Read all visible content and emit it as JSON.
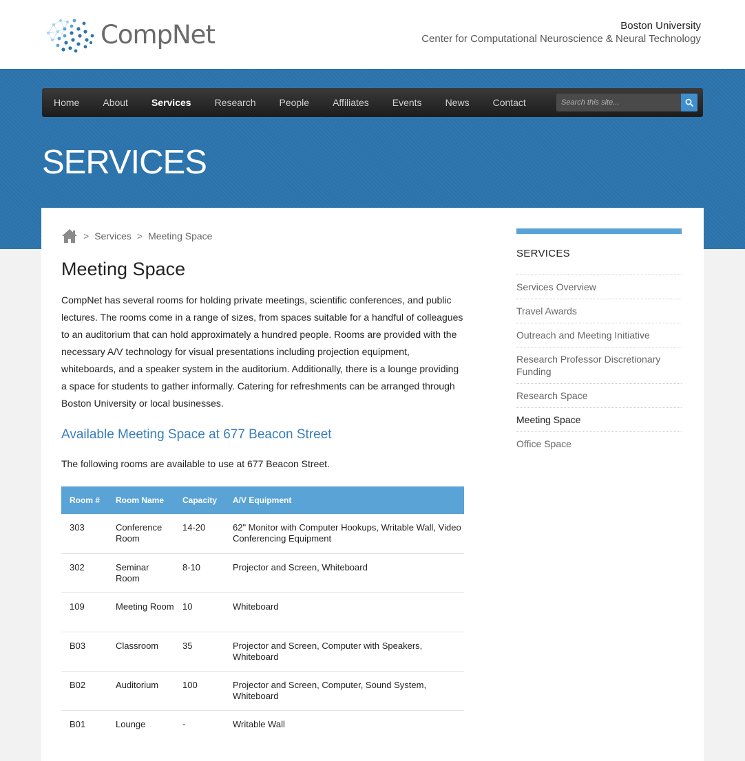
{
  "header": {
    "logo_text": "CompNet",
    "institution_name": "Boston University",
    "institution_sub": "Center for Computational Neuroscience & Neural Technology"
  },
  "nav": {
    "items": [
      {
        "label": "Home"
      },
      {
        "label": "About"
      },
      {
        "label": "Services",
        "active": true
      },
      {
        "label": "Research"
      },
      {
        "label": "People"
      },
      {
        "label": "Affiliates"
      },
      {
        "label": "Events"
      },
      {
        "label": "News"
      },
      {
        "label": "Contact"
      }
    ],
    "search_placeholder": "Search this site...",
    "search_icon": "search-icon"
  },
  "page": {
    "heading": "SERVICES"
  },
  "breadcrumb": {
    "home_icon": "home-icon",
    "sep": ">",
    "items": [
      "Services",
      "Meeting Space"
    ]
  },
  "content": {
    "title": "Meeting Space",
    "intro": "CompNet has several rooms for holding private meetings, scientific conferences, and public lectures. The rooms come in a range of sizes, from spaces suitable for a handful of colleagues to an auditorium that can hold approximately a hundred people. Rooms are provided with the necessary A/V technology for visual presentations including projection equipment, whiteboards, and a speaker system in the auditorium. Additionally, there is a lounge providing a space for students to gather informally. Catering for refreshments can be arranged through Boston University or local businesses.",
    "subheading": "Available Meeting Space at 677 Beacon Street",
    "rooms_intro": "The following rooms are available to use at 677 Beacon Street."
  },
  "table": {
    "headers": [
      "Room #",
      "Room Name",
      "Capacity",
      "A/V Equipment"
    ],
    "rows": [
      [
        "303",
        "Conference Room",
        "14-20",
        "62\" Monitor with Computer Hookups, Writable Wall, Video Conferencing Equipment"
      ],
      [
        "302",
        "Seminar Room",
        "8-10",
        "Projector and Screen, Whiteboard"
      ],
      [
        "109",
        "Meeting Room",
        "10",
        "Whiteboard"
      ],
      [
        "B03",
        "Classroom",
        "35",
        "Projector and Screen, Computer with Speakers, Whiteboard"
      ],
      [
        "B02",
        "Auditorium",
        "100",
        "Projector and Screen, Computer, Sound System, Whiteboard"
      ],
      [
        "B01",
        "Lounge",
        "-",
        "Writable Wall"
      ]
    ]
  },
  "sidebar": {
    "title": "SERVICES",
    "links": [
      {
        "label": "Services Overview"
      },
      {
        "label": "Travel Awards"
      },
      {
        "label": "Outreach and Meeting Initiative"
      },
      {
        "label": "Research Professor Discretionary Funding"
      },
      {
        "label": "Research Space"
      },
      {
        "label": "Meeting Space",
        "current": true
      },
      {
        "label": "Office Space"
      }
    ]
  },
  "colors": {
    "band_blue": "#2c74ad",
    "accent_blue": "#5aa3d6",
    "link_blue": "#3a7eb9",
    "nav_dark": "#222222"
  }
}
